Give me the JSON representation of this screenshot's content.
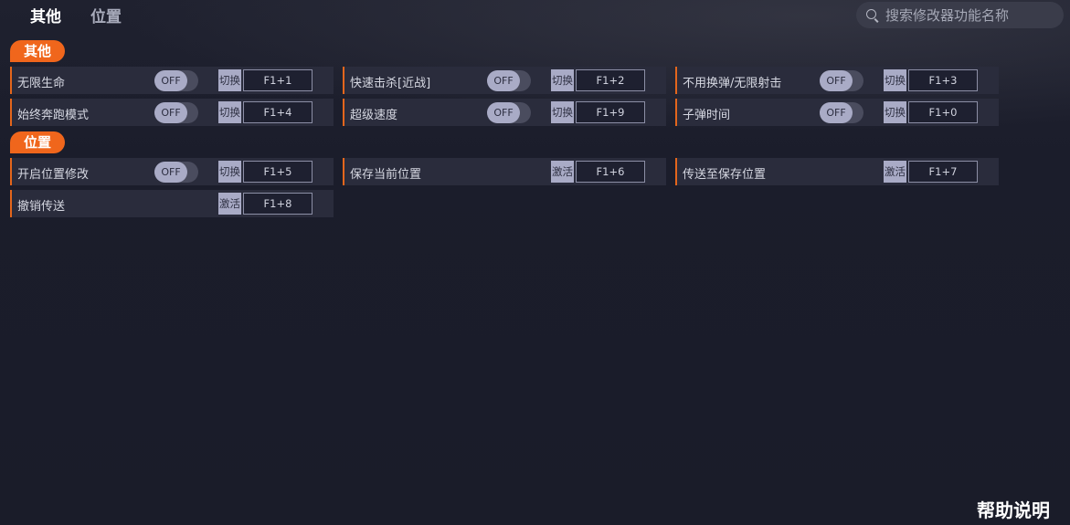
{
  "tabs": [
    {
      "label": "其他"
    },
    {
      "label": "位置"
    }
  ],
  "search": {
    "placeholder": "搜索修改器功能名称"
  },
  "sections": [
    {
      "title": "其他",
      "rows": [
        {
          "label": "无限生命",
          "toggle": "OFF",
          "action": "切换",
          "hotkey": "F1+1"
        },
        {
          "label": "快速击杀[近战]",
          "toggle": "OFF",
          "action": "切换",
          "hotkey": "F1+2"
        },
        {
          "label": "不用换弹/无限射击",
          "toggle": "OFF",
          "action": "切换",
          "hotkey": "F1+3"
        },
        {
          "label": "始终奔跑模式",
          "toggle": "OFF",
          "action": "切换",
          "hotkey": "F1+4"
        },
        {
          "label": "超级速度",
          "toggle": "OFF",
          "action": "切换",
          "hotkey": "F1+9"
        },
        {
          "label": "子弹时间",
          "toggle": "OFF",
          "action": "切换",
          "hotkey": "F1+0"
        }
      ]
    },
    {
      "title": "位置",
      "rows": [
        {
          "label": "开启位置修改",
          "toggle": "OFF",
          "action": "切换",
          "hotkey": "F1+5"
        },
        {
          "label": "保存当前位置",
          "action": "激活",
          "hotkey": "F1+6"
        },
        {
          "label": "传送至保存位置",
          "action": "激活",
          "hotkey": "F1+7"
        },
        {
          "label": "撤销传送",
          "action": "激活",
          "hotkey": "F1+8"
        }
      ]
    }
  ],
  "help": {
    "label": "帮助说明"
  },
  "colors": {
    "accent": "#f0661c",
    "background": "#1a1c2a",
    "row": "#2a2c3c"
  }
}
